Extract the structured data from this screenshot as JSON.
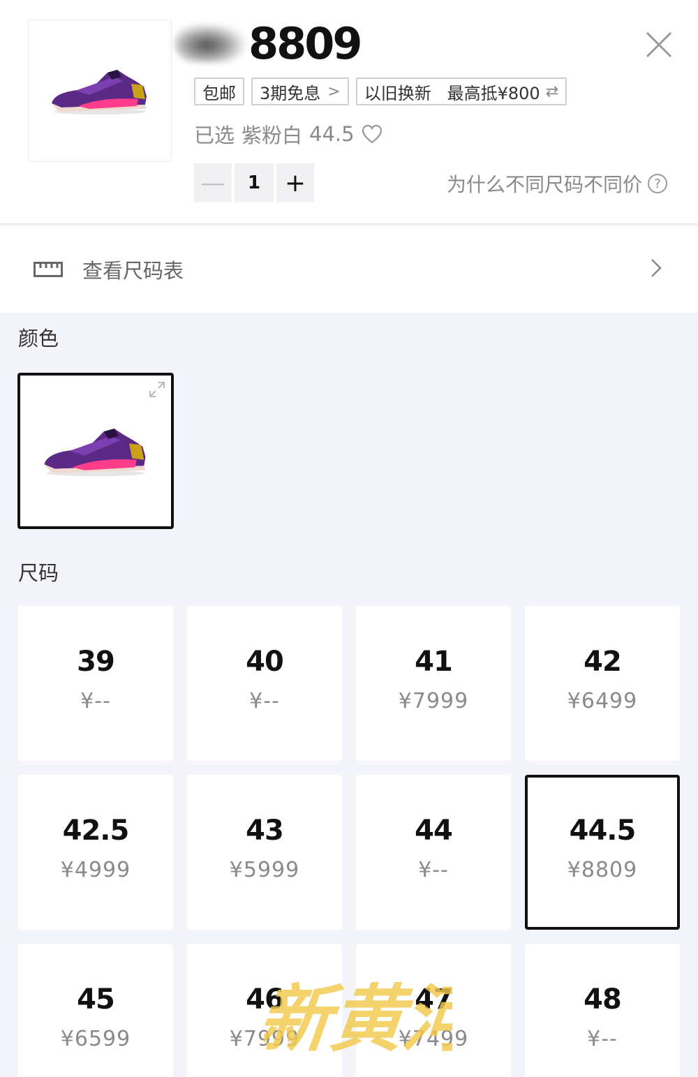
{
  "header": {
    "price_value": "8809",
    "tags": [
      {
        "label": "包邮",
        "suffix": ""
      },
      {
        "label": "3期免息",
        "suffix": ">"
      },
      {
        "label": "以旧换新   最高抵¥800",
        "suffix": "⇄"
      }
    ],
    "selected_prefix": "已选",
    "selected_color": "紫粉白",
    "selected_size": "44.5",
    "quantity": "1",
    "minus_label": "—",
    "plus_label": "+",
    "why_text": "为什么不同尺码不同价",
    "why_icon_text": "?"
  },
  "size_chart": {
    "label": "查看尺码表"
  },
  "color_section": {
    "title": "颜色"
  },
  "size_section": {
    "title": "尺码",
    "items": [
      {
        "size": "39",
        "price": "¥--",
        "selected": false
      },
      {
        "size": "40",
        "price": "¥--",
        "selected": false
      },
      {
        "size": "41",
        "price": "¥7999",
        "selected": false
      },
      {
        "size": "42",
        "price": "¥6499",
        "selected": false
      },
      {
        "size": "42.5",
        "price": "¥4999",
        "selected": false
      },
      {
        "size": "43",
        "price": "¥5999",
        "selected": false
      },
      {
        "size": "44",
        "price": "¥--",
        "selected": false
      },
      {
        "size": "44.5",
        "price": "¥8809",
        "selected": true
      },
      {
        "size": "45",
        "price": "¥6599",
        "selected": false
      },
      {
        "size": "46",
        "price": "¥7999",
        "selected": false
      },
      {
        "size": "47",
        "price": "¥7499",
        "selected": false
      },
      {
        "size": "48",
        "price": "¥--",
        "selected": false
      }
    ]
  },
  "watermark": {
    "text": "新黄河"
  },
  "colors": {
    "selected_border": "#111111",
    "muted_text": "#8a8a8e",
    "shoe_purple": "#5b2a86",
    "shoe_pink": "#ff3d8b",
    "watermark": "#f2c94c"
  }
}
